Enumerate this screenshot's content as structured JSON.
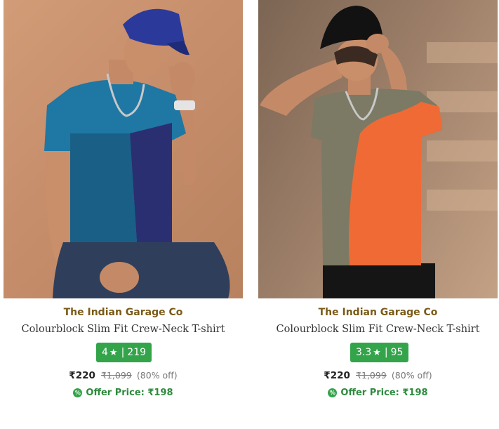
{
  "products": [
    {
      "brand": "The Indian Garage Co",
      "title": "Colourblock Slim Fit Crew-Neck T-shirt",
      "rating": "4",
      "rating_count": "219",
      "price": "₹220",
      "mrp": "₹1,099",
      "discount": "(80% off)",
      "offer_price": "Offer Price: ₹198"
    },
    {
      "brand": "The Indian Garage Co",
      "title": "Colourblock Slim Fit Crew-Neck T-shirt",
      "rating": "3.3",
      "rating_count": "95",
      "price": "₹220",
      "mrp": "₹1,099",
      "discount": "(80% off)",
      "offer_price": "Offer Price: ₹198"
    }
  ],
  "icons": {
    "star": "star-icon",
    "offer": "offer-tag-icon"
  },
  "colors": {
    "rating_badge": "#34a44b",
    "brand": "#7a5b17",
    "offer_text": "#2e8b3e"
  }
}
